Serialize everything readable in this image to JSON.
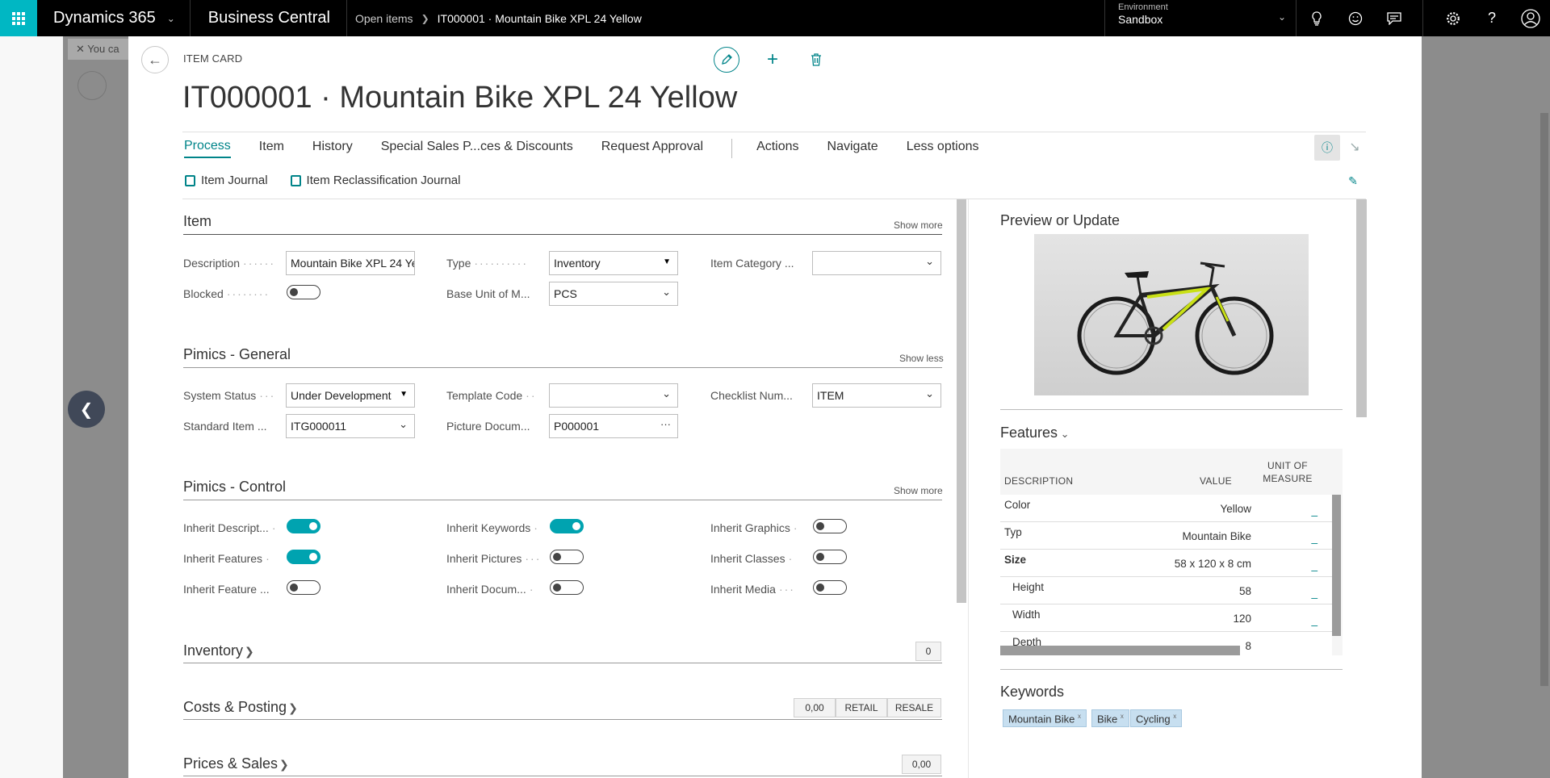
{
  "topbar": {
    "product": "Dynamics 365",
    "app": "Business Central",
    "breadcrumb_parent": "Open items",
    "breadcrumb_current": "IT000001 · Mountain Bike XPL 24 Yellow",
    "environment_label": "Environment",
    "environment_value": "Sandbox"
  },
  "background": {
    "notification_text": "You ca"
  },
  "card": {
    "type_label": "ITEM CARD",
    "title": "IT000001 · Mountain Bike XPL 24 Yellow"
  },
  "actionbar": {
    "items": [
      "Process",
      "Item",
      "History",
      "Special Sales P...ces & Discounts",
      "Request Approval"
    ],
    "items2": [
      "Actions",
      "Navigate",
      "Less options"
    ],
    "sub_items": [
      "Item Journal",
      "Item Reclassification Journal"
    ]
  },
  "sections": {
    "item": {
      "title": "Item",
      "show": "Show more",
      "description_label": "Description",
      "description_value": "Mountain Bike XPL 24 Ye",
      "type_label": "Type",
      "type_value": "Inventory",
      "item_category_label": "Item Category ...",
      "item_category_value": "",
      "blocked_label": "Blocked",
      "base_uom_label": "Base Unit of M...",
      "base_uom_value": "PCS"
    },
    "pimics_general": {
      "title": "Pimics - General",
      "show": "Show less",
      "system_status_label": "System Status",
      "system_status_value": "Under Development",
      "template_code_label": "Template Code",
      "template_code_value": "",
      "checklist_label": "Checklist Num...",
      "checklist_value": "ITEM",
      "standard_item_label": "Standard Item ...",
      "standard_item_value": "ITG000011",
      "picture_doc_label": "Picture Docum...",
      "picture_doc_value": "P000001"
    },
    "pimics_control": {
      "title": "Pimics - Control",
      "show": "Show more",
      "inherit_descr_label": "Inherit Descript...",
      "inherit_features_label": "Inherit Features",
      "inherit_feature_x_label": "Inherit Feature ...",
      "inherit_keywords_label": "Inherit Keywords",
      "inherit_pictures_label": "Inherit Pictures",
      "inherit_docum_label": "Inherit Docum...",
      "inherit_graphics_label": "Inherit Graphics",
      "inherit_classes_label": "Inherit Classes",
      "inherit_media_label": "Inherit Media"
    },
    "inventory": {
      "title": "Inventory",
      "badge": "0"
    },
    "costs": {
      "title": "Costs & Posting",
      "badge1": "0,00",
      "badge2": "RETAIL",
      "badge3": "RESALE"
    },
    "prices": {
      "title": "Prices & Sales",
      "badge": "0,00"
    }
  },
  "factbox": {
    "preview_title": "Preview or Update",
    "features_title": "Features",
    "features_head": {
      "description": "DESCRIPTION",
      "value": "VALUE",
      "uom_1": "UNIT OF",
      "uom_2": "MEASURE"
    },
    "features_rows": [
      {
        "description": "Color",
        "value": "Yellow",
        "uom": "_"
      },
      {
        "description": "Typ",
        "value": "Mountain Bike",
        "uom": "_"
      },
      {
        "description": "Size",
        "value": "58 x 120 x 8 cm",
        "uom": "_"
      },
      {
        "description": "Height",
        "value": "58",
        "uom": "_"
      },
      {
        "description": "Width",
        "value": "120",
        "uom": "_"
      },
      {
        "description": "Depth",
        "value": "8",
        "uom": ""
      }
    ],
    "keywords_title": "Keywords",
    "keywords": [
      "Mountain Bike",
      "Bike",
      "Cycling"
    ],
    "keyword_remove": "x"
  }
}
